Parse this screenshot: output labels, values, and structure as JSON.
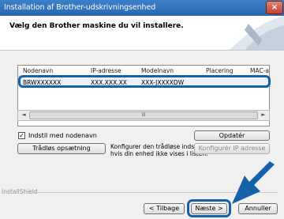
{
  "window": {
    "title": "Installation af Brother-udskrivningsenhed",
    "close_label": "×"
  },
  "header": {
    "heading": "Vælg den Brother maskine du vil installere."
  },
  "list": {
    "columns": [
      "Nodenavn",
      "IP-adresse",
      "Modelnavn",
      "Placering",
      "MAC-ad"
    ],
    "rows": [
      {
        "node": "BRWXXXXXX",
        "ip": "XXX.XXX.XX",
        "model": "XXX-JXXXXDW",
        "location": "",
        "mac": ""
      }
    ]
  },
  "scrollbar": {
    "left_arrow": "◄",
    "right_arrow": "►",
    "grip": "III"
  },
  "options": {
    "node_checkbox_label": "Indstil med nodenavn",
    "node_checkbox_checked": true,
    "node_checkbox_mark": "✓"
  },
  "buttons": {
    "update": "Opdatér",
    "wireless_setup": "Trådløs opsætning",
    "configure_ip": "Konfigurér IP adresse",
    "back": "< Tilbage",
    "next": "Næste >",
    "cancel": "Annuller"
  },
  "wireless_description": [
    "Konfigurer den trådløse indstilling,",
    "hvis din enhed ikke vises i listen."
  ],
  "footer": {
    "installshield": "InstallShield"
  },
  "colors": {
    "highlight": "#1662a8",
    "titlebar": "#2a66b2"
  }
}
